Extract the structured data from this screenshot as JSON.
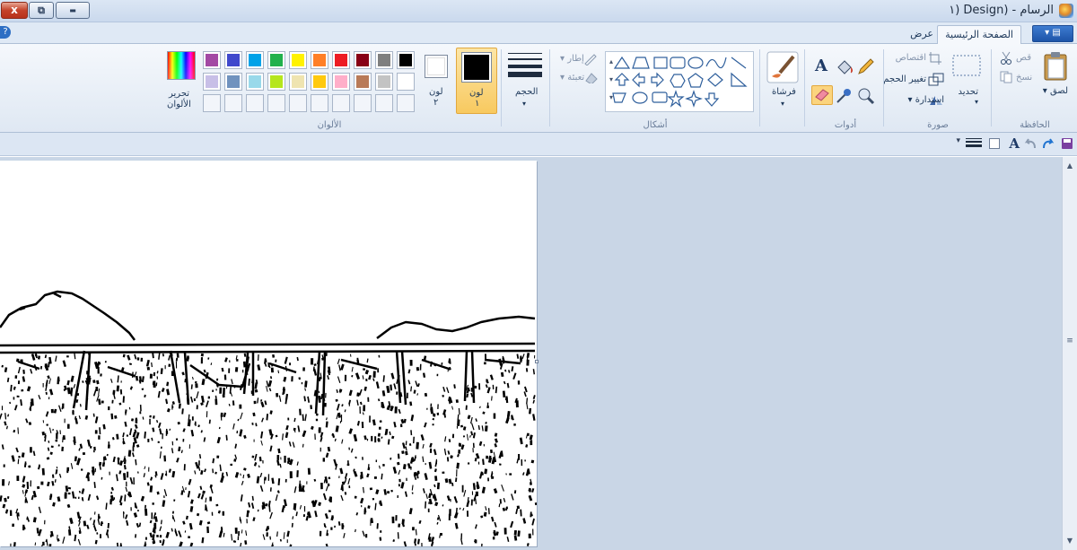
{
  "window": {
    "title": "الرسام - (Design (١",
    "close_glyph": "x",
    "maximize_glyph": "⧉",
    "minimize_glyph": "▬"
  },
  "tabs": {
    "home": "الصفحة الرئيسية",
    "view": "عرض",
    "app_menu": "▾ ▤"
  },
  "help_glyph": "?",
  "clipboard": {
    "label": "الحافظة",
    "paste": "لصق",
    "cut": "قص",
    "copy": "نسخ"
  },
  "image": {
    "label": "صورة",
    "select": "تحديد",
    "crop": "اقتصاص",
    "resize": "تغيير الحجم",
    "rotate": "استدارة"
  },
  "tools": {
    "label": "أدوات"
  },
  "brushes": {
    "label": "فرشاة"
  },
  "shapes": {
    "label": "أشكال",
    "outline": "إطار",
    "fill": "تعبئة"
  },
  "size": {
    "label": "الحجم"
  },
  "colors": {
    "label": "الألوان",
    "color1": "لون",
    "color1_num": "١",
    "color2": "لون",
    "color2_num": "٢",
    "edit_line1": "تحرير",
    "edit_line2": "الألوان",
    "color1_value": "#000000",
    "color2_value": "#ffffff",
    "palette_row1": [
      "#000000",
      "#7f7f7f",
      "#880015",
      "#ed1c24",
      "#ff7f27",
      "#fff200",
      "#22b14c",
      "#00a2e8",
      "#3f48cc",
      "#a349a4"
    ],
    "palette_row2": [
      "#ffffff",
      "#c3c3c3",
      "#b97a57",
      "#ffaec9",
      "#ffc90e",
      "#efe4b0",
      "#b5e61d",
      "#99d9ea",
      "#7092be",
      "#c8bfe7"
    ]
  },
  "canvas_image": "black-and-white edge sketch of a bridge with hills above a field"
}
